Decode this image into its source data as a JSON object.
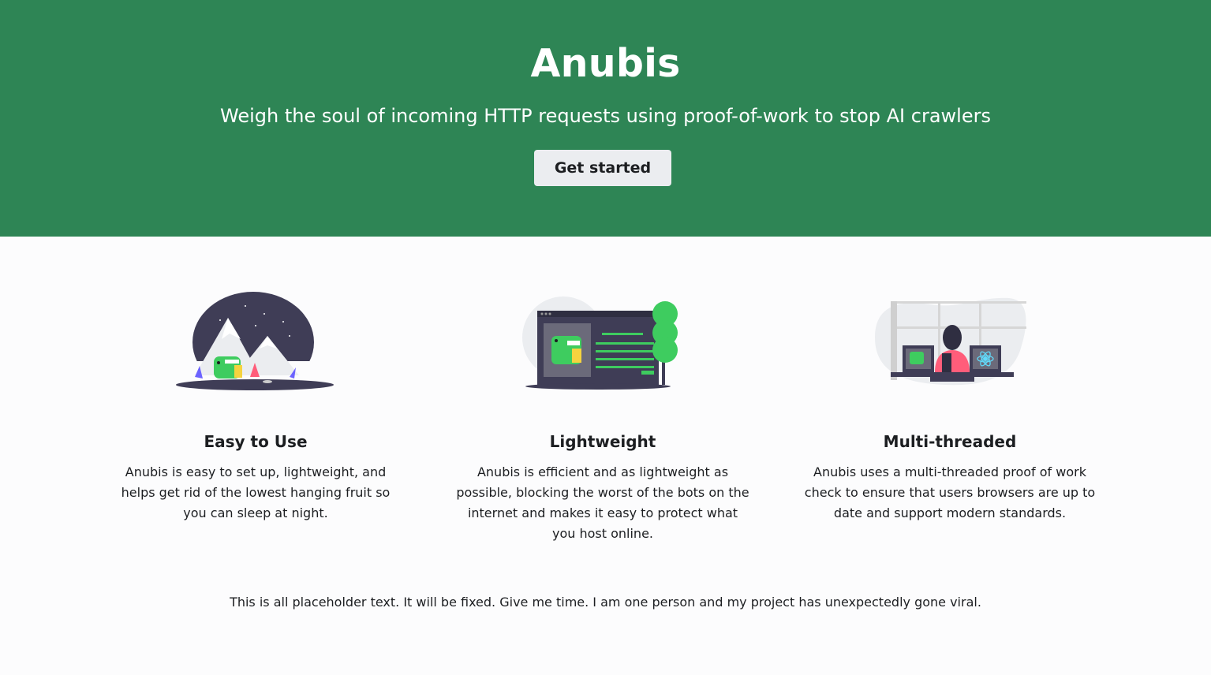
{
  "hero": {
    "title": "Anubis",
    "subtitle": "Weigh the soul of incoming HTTP requests using proof-of-work to stop AI crawlers",
    "cta_label": "Get started",
    "background_color": "#2e8555"
  },
  "features": [
    {
      "illustration": "mountain-night-illustration",
      "title": "Easy to Use",
      "description": "Anubis is easy to set up, lightweight, and helps get rid of the lowest hanging fruit so you can sleep at night."
    },
    {
      "illustration": "browser-window-illustration",
      "title": "Lightweight",
      "description": "Anubis is efficient and as lightweight as possible, blocking the worst of the bots on the internet and makes it easy to protect what you host online."
    },
    {
      "illustration": "person-at-monitors-illustration",
      "title": "Multi-threaded",
      "description": "Anubis uses a multi-threaded proof of work check to ensure that users browsers are up to date and support modern standards."
    }
  ],
  "footer_note": "This is all placeholder text. It will be fixed. Give me time. I am one person and my project has unexpectedly gone viral.",
  "colors": {
    "accent_green": "#2e8555",
    "illustration_dark": "#3f3d56",
    "illustration_green": "#3ecc5f"
  }
}
